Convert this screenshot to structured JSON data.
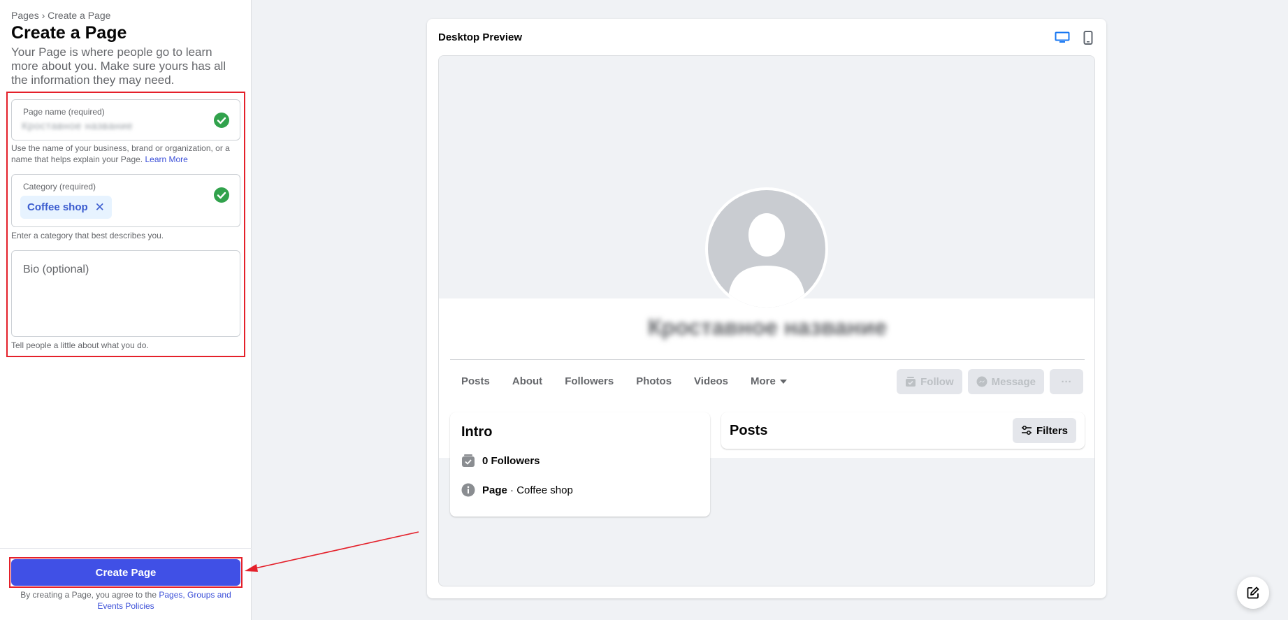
{
  "sidebar": {
    "breadcrumb": "Pages › Create a Page",
    "title": "Create a Page",
    "intro": "Your Page is where people go to learn more about you. Make sure yours has all the information they may need.",
    "page_name": {
      "label": "Page name (required)",
      "value": "Кроставное название",
      "help": "Use the name of your business, brand or organization, or a name that helps explain your Page.",
      "learn_more": "Learn More"
    },
    "category": {
      "label": "Category (required)",
      "chip": "Coffee shop",
      "chip_remove": "✕",
      "help": "Enter a category that best describes you."
    },
    "bio": {
      "placeholder": "Bio (optional)",
      "help": "Tell people a little about what you do."
    },
    "create_button": "Create Page",
    "terms_prefix": "By creating a Page, you agree to the",
    "terms_link": "Pages, Groups and Events Policies"
  },
  "preview": {
    "title": "Desktop Preview",
    "page_name": "Кроставное название",
    "tabs": [
      "Posts",
      "About",
      "Followers",
      "Photos",
      "Videos",
      "More"
    ],
    "actions": {
      "follow": "Follow",
      "message": "Message",
      "more": "···"
    },
    "intro": {
      "title": "Intro",
      "followers": "0 Followers",
      "page_label": "Page",
      "page_category": "· Coffee shop"
    },
    "posts": {
      "title": "Posts",
      "filters": "Filters"
    }
  },
  "colors": {
    "accent": "#4050e6",
    "check": "#31a24c",
    "highlight": "#e4202a",
    "link": "#3b4fd8"
  }
}
